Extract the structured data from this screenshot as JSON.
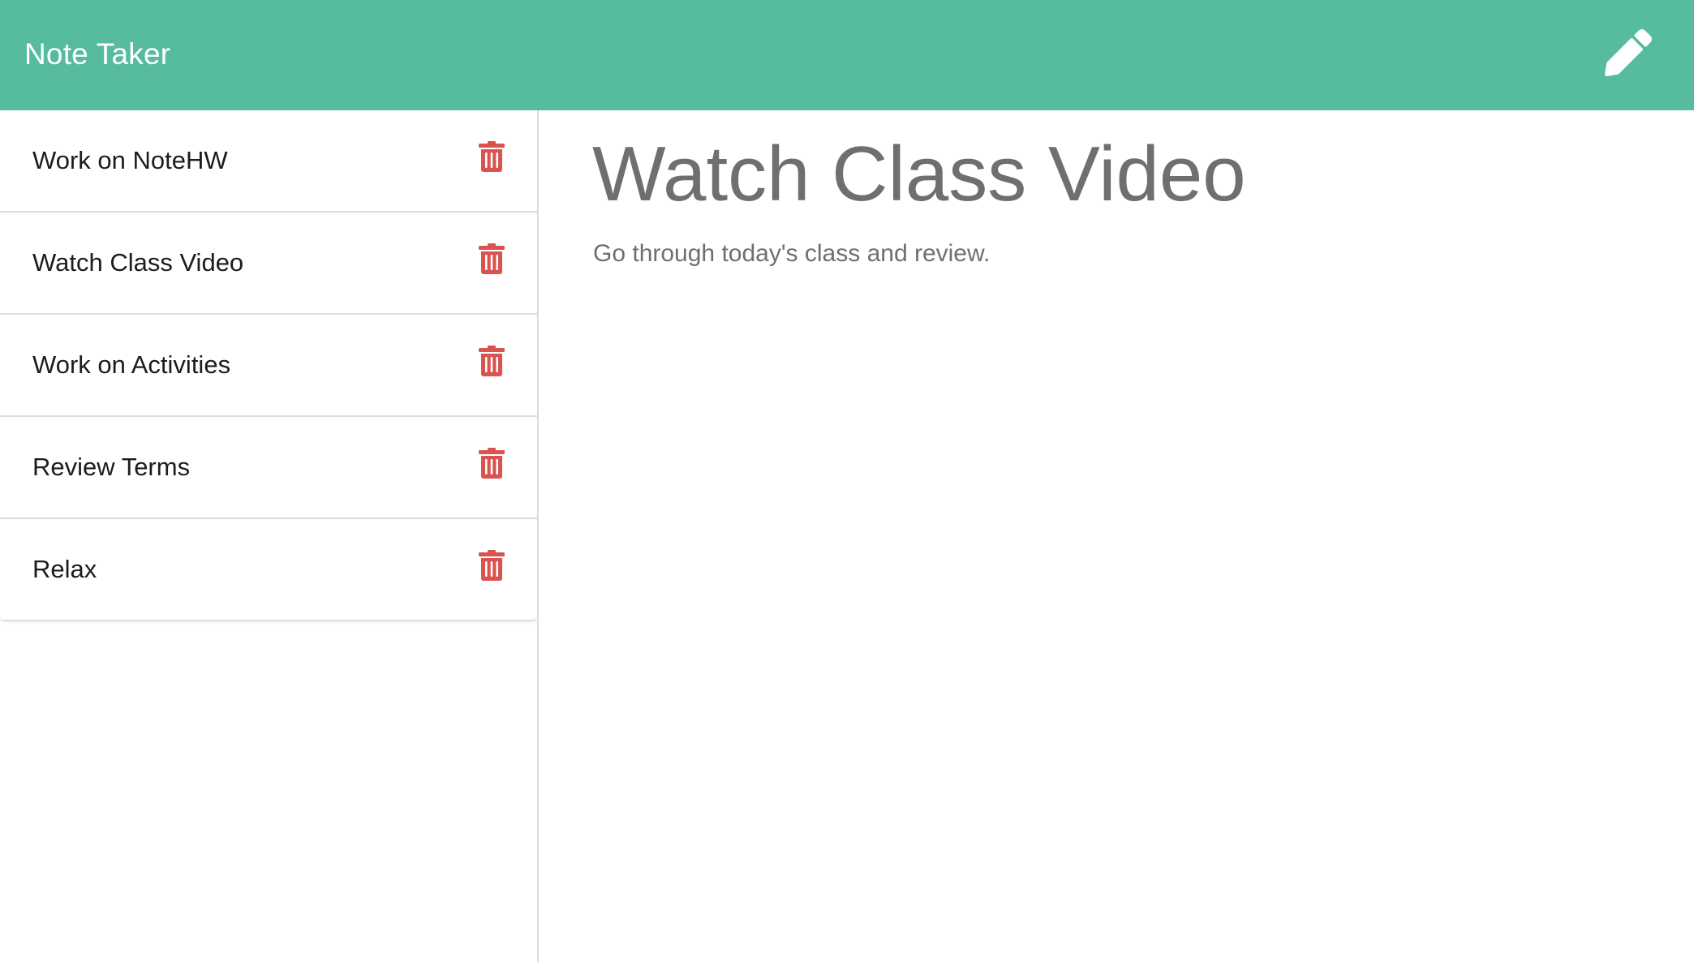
{
  "app": {
    "title": "Note Taker",
    "new_note_icon": "pencil-icon",
    "accent_color": "#57bb9d",
    "delete_color": "#d9534f"
  },
  "sidebar": {
    "notes": [
      {
        "title": "Work on NoteHW",
        "delete_icon": "trash-icon"
      },
      {
        "title": "Watch Class Video",
        "delete_icon": "trash-icon"
      },
      {
        "title": "Work on Activities",
        "delete_icon": "trash-icon"
      },
      {
        "title": "Review Terms",
        "delete_icon": "trash-icon"
      },
      {
        "title": "Relax",
        "delete_icon": "trash-icon"
      }
    ]
  },
  "main": {
    "note_title": "Watch Class Video",
    "note_text": "Go through today's class and review."
  }
}
